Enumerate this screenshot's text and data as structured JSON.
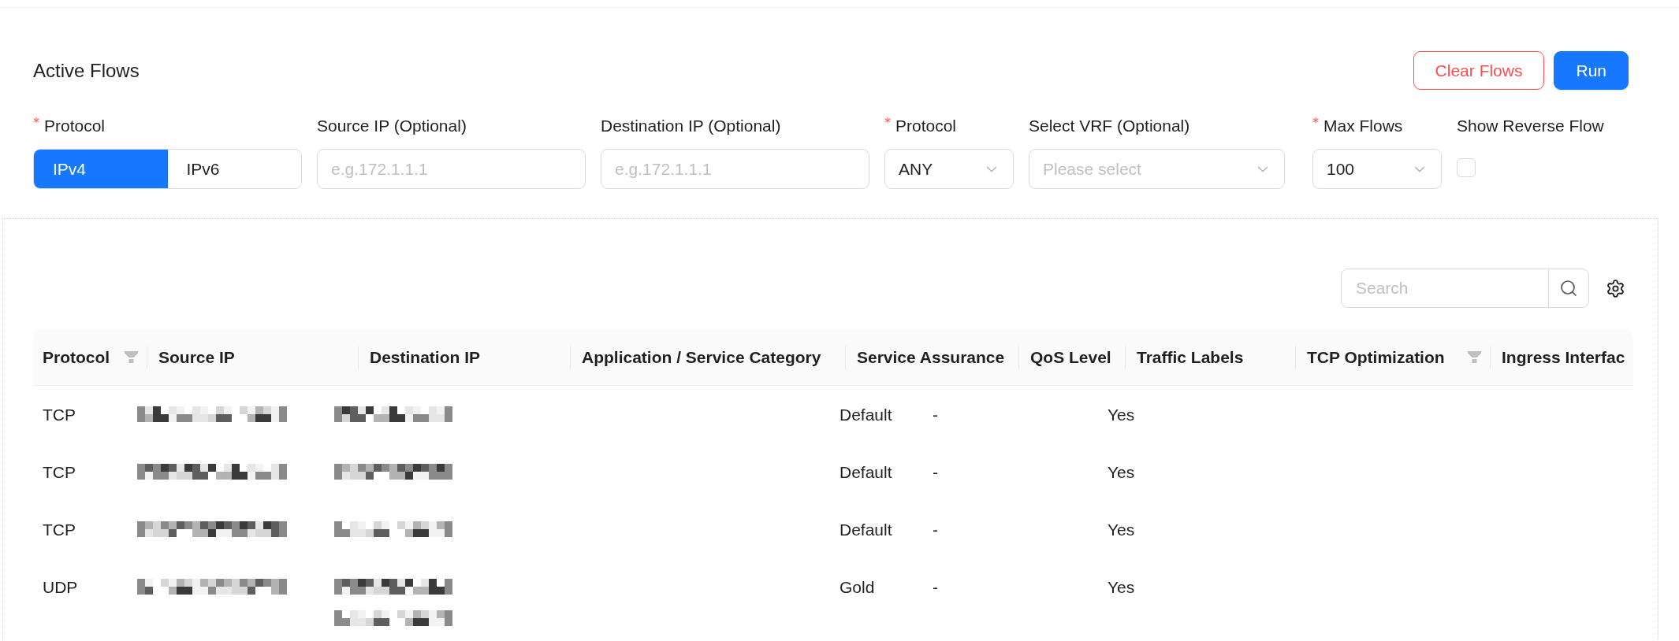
{
  "header": {
    "title": "Active Flows",
    "buttons": [
      {
        "label": "Clear Flows",
        "kind": "danger"
      },
      {
        "label": "Run",
        "kind": "primary"
      }
    ]
  },
  "form": {
    "fields": [
      {
        "kind": "segmented",
        "required_mark": "*",
        "label": "Protocol",
        "options": [
          {
            "label": "IPv4",
            "selected": true
          },
          {
            "label": "IPv6",
            "selected": false
          }
        ]
      },
      {
        "kind": "input",
        "label": "Source IP (Optional)",
        "placeholder": "e.g.172.1.1.1"
      },
      {
        "kind": "input",
        "label": "Destination IP (Optional)",
        "placeholder": "e.g.172.1.1.1"
      },
      {
        "kind": "select",
        "required_mark": "*",
        "label": "Protocol",
        "value": "ANY"
      },
      {
        "kind": "select",
        "label": "Select VRF (Optional)",
        "placeholder": "Please select"
      },
      {
        "kind": "select",
        "required_mark": "*",
        "label": "Max Flows",
        "value": "100"
      },
      {
        "kind": "checkbox",
        "label": "Show Reverse Flow",
        "checked": false
      }
    ]
  },
  "table_toolbar": {
    "search": {
      "placeholder": "Search"
    }
  },
  "table": {
    "columns": [
      {
        "label": "Protocol",
        "filter": true
      },
      {
        "label": "Source IP",
        "filter": false
      },
      {
        "label": "Destination IP",
        "filter": false
      },
      {
        "label": "Application / Service Category",
        "filter": false
      },
      {
        "label": "Service Assurance",
        "filter": false
      },
      {
        "label": "QoS Level",
        "filter": false
      },
      {
        "label": "Traffic Labels",
        "filter": false
      },
      {
        "label": "TCP Optimization",
        "filter": true
      },
      {
        "label": "Ingress Interfac",
        "filter": false
      }
    ],
    "rows": [
      {
        "cells": [
          "TCP",
          "Default",
          "-",
          "Yes"
        ],
        "destination_two_lines": false
      },
      {
        "cells": [
          "TCP",
          "Default",
          "-",
          "Yes"
        ],
        "destination_two_lines": false
      },
      {
        "cells": [
          "TCP",
          "Default",
          "-",
          "Yes"
        ],
        "destination_two_lines": false
      },
      {
        "cells": [
          "UDP",
          "Gold",
          "-",
          "Yes"
        ],
        "destination_two_lines": true
      }
    ]
  }
}
